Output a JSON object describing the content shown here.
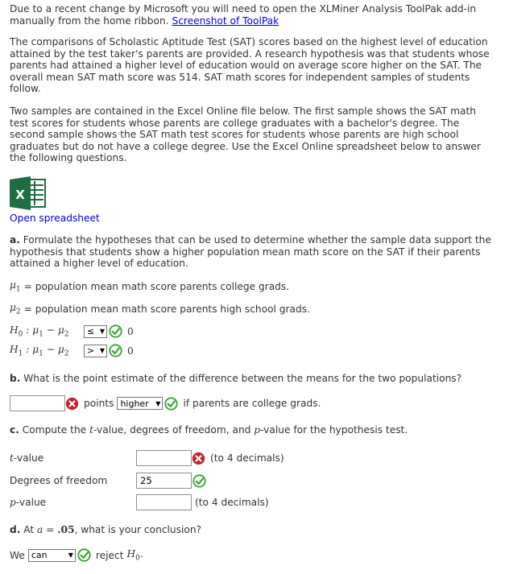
{
  "notice": {
    "text": "Due to a recent change by Microsoft you will need to open the XLMiner Analysis ToolPak add-in manually from the home ribbon. ",
    "link": "Screenshot of ToolPak"
  },
  "intro": "The comparisons of Scholastic Aptitude Test (SAT) scores based on the highest level of education attained by the test taker's parents are provided. A research hypothesis was that students whose parents had attained a higher level of education would on average score higher on the SAT. The overall mean SAT math score was 514. SAT math scores for independent samples of students follow.",
  "samples": "Two samples are contained in the Excel Online file below. The first sample shows the SAT math test scores for students whose parents are college graduates with a bachelor's degree. The second sample shows the SAT math test scores for students whose parents are high school graduates but do not have a college degree. Use the Excel Online spreadsheet below to answer the following questions.",
  "spreadsheet": {
    "icon": "excel-icon",
    "link": "Open spreadsheet"
  },
  "part_a": {
    "label": "a.",
    "text": " Formulate the hypotheses that can be used to determine whether the sample data support the hypothesis that students show a higher population mean math score on the SAT if their parents attained a higher level of education.",
    "mu1_def": "= population mean math score parents college grads.",
    "mu2_def": "= population mean math score parents high school grads.",
    "h0": {
      "operator": "≤",
      "value": "0",
      "status": "correct"
    },
    "h1": {
      "operator": ">",
      "value": "0",
      "status": "correct"
    }
  },
  "part_b": {
    "label": "b.",
    "text": " What is the point estimate of the difference between the means for the two populations?",
    "estimate_value": "",
    "estimate_status": "incorrect",
    "points_label": "points",
    "direction": "higher",
    "direction_status": "correct",
    "suffix": "if parents are college grads."
  },
  "part_c": {
    "label": "c.",
    "text_pre": " Compute the ",
    "t_sym": "t",
    "text_mid": "-value, degrees of freedom, and ",
    "p_sym": "p",
    "text_post": "-value for the hypothesis test.",
    "t_label_suffix": "-value",
    "t_value": "",
    "t_status": "incorrect",
    "t_hint": "(to 4 decimals)",
    "df_label": "Degrees of freedom",
    "df_value": "25",
    "df_status": "correct",
    "p_label_suffix": "-value",
    "p_value": "",
    "p_hint": "(to 4 decimals)"
  },
  "part_d": {
    "label": "d.",
    "text_pre": " At ",
    "alpha_sym": "a",
    "alpha_eq": " = ",
    "alpha_val": ".05",
    "text_post": ", what is your conclusion?",
    "we": "We",
    "choice": "can",
    "choice_status": "correct",
    "reject": "reject"
  },
  "colors": {
    "correct": "#3aa335",
    "incorrect": "#c8202a",
    "link": "#0000ee",
    "excel": "#1d6f42"
  }
}
